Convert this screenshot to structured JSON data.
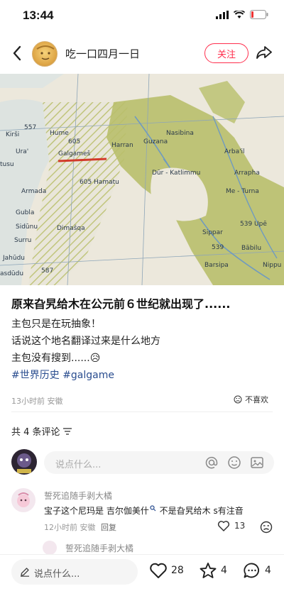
{
  "status": {
    "time": "13:44"
  },
  "header": {
    "username": "吃一口四月一日",
    "follow_label": "关注"
  },
  "map": {
    "labels": [
      "Kirši",
      "557",
      "Hume",
      "605",
      "Galgameš",
      "Harran",
      "Nasibina",
      "Guzana",
      "Arba'il",
      "Ura'",
      "tusu",
      "605 Hamatu",
      "Dūr - Katlimmu",
      "Arrapha",
      "Armada",
      "Me - Turna",
      "Gubla",
      "Sidūnu",
      "Dimašqa",
      "539 Upē",
      "Surru",
      "539",
      "Bābilu",
      "Jahūdu",
      "Sippar",
      "asdūdu",
      "587",
      "Barsipa",
      "Nippu"
    ]
  },
  "post": {
    "title": "原来旮旯给木在公元前６世纪就出现了......",
    "lines": [
      "主包只是在玩抽象！",
      "话说这个地名翻译过来是什么地方",
      "主包没有搜到......😥"
    ],
    "tags": [
      "#世界历史",
      "#galgame"
    ],
    "meta": "13小时前 安徽",
    "dislike": "不喜欢"
  },
  "comments": {
    "count_label": "共 4 条评论",
    "input_placeholder": "说点什么...",
    "items": [
      {
        "name": "誓死追随手剥大橘",
        "text_a": "宝子这个尼玛是 吉尔伽美什",
        "text_b": " 不是旮旯给木 s有注音",
        "meta": "12小时前 安徽",
        "reply": "回复",
        "likes": "13"
      }
    ],
    "reply_name": "誓死追随手剥大橘"
  },
  "bottom": {
    "placeholder": "说点什么...",
    "likes": "28",
    "stars": "4",
    "comments": "4"
  },
  "colors": {
    "accent": "#ff2e4d",
    "tag": "#2a4d8f",
    "map_green": "#b9bf6b"
  }
}
